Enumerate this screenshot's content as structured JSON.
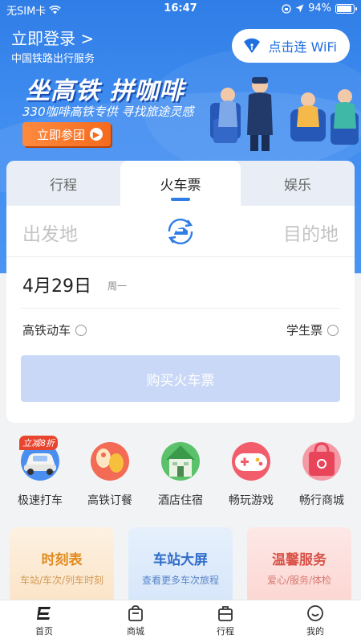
{
  "status_bar": {
    "carrier": "无SIM卡",
    "time": "16:47",
    "battery": "94%",
    "battery_level": 0.94
  },
  "header": {
    "login": "立即登录 >",
    "subtitle": "中国铁路出行服务",
    "wifi_button": "点击连 WiFi"
  },
  "banner": {
    "title": "坐高铁 拼咖啡",
    "subtitle": "330咖啡高铁专供  寻找旅途灵感",
    "cta": "立即参团"
  },
  "tabs": [
    "行程",
    "火车票",
    "娱乐"
  ],
  "booking": {
    "from_placeholder": "出发地",
    "to_placeholder": "目的地",
    "date": "4月29日",
    "weekday": "周一",
    "option_highspeed": "高铁动车",
    "option_student": "学生票",
    "buy_button": "购买火车票"
  },
  "services": [
    {
      "label": "极速打车",
      "badge": "立减8折"
    },
    {
      "label": "高铁订餐"
    },
    {
      "label": "酒店住宿"
    },
    {
      "label": "畅玩游戏"
    },
    {
      "label": "畅行商城"
    }
  ],
  "features": [
    {
      "title": "时刻表",
      "sub": "车站/车次/列车时刻"
    },
    {
      "title": "车站大屏",
      "sub": "查看更多车次旅程"
    },
    {
      "title": "温馨服务",
      "sub": "爱心/服务/体检"
    }
  ],
  "bottom_nav": [
    "首页",
    "商城",
    "行程",
    "我的"
  ],
  "colors": {
    "primary": "#2f7de6",
    "button_disabled": "#c9d8f7",
    "promo_orange": "#f46a1e"
  }
}
